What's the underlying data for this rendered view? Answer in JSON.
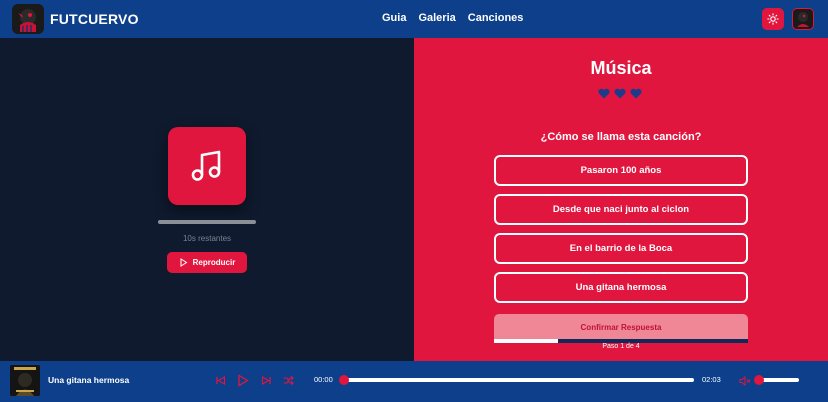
{
  "header": {
    "brand": "FUTCUERVO",
    "nav": [
      "Guia",
      "Galeria",
      "Canciones"
    ],
    "theme_icon": "sun-icon",
    "accent": "#e0163f",
    "bar_color": "#0d3f8a"
  },
  "left": {
    "icon": "music-note-icon",
    "remaining": "10s restantes",
    "play_label": "Reproducir"
  },
  "quiz": {
    "title": "Música",
    "lives": 3,
    "question": "¿Cómo se llama esta canción?",
    "options": [
      "Pasaron 100 años",
      "Desde que naci junto al ciclon",
      "En el barrio de la Boca",
      "Una gitana hermosa"
    ],
    "confirm_label": "Confirmar Respuesta",
    "step_text": "Paso 1 de 4",
    "progress": 0.25
  },
  "player": {
    "track_title": "Una gitana hermosa",
    "current_time": "00:00",
    "duration": "02:03",
    "seek_progress": 0,
    "volume": 0
  }
}
